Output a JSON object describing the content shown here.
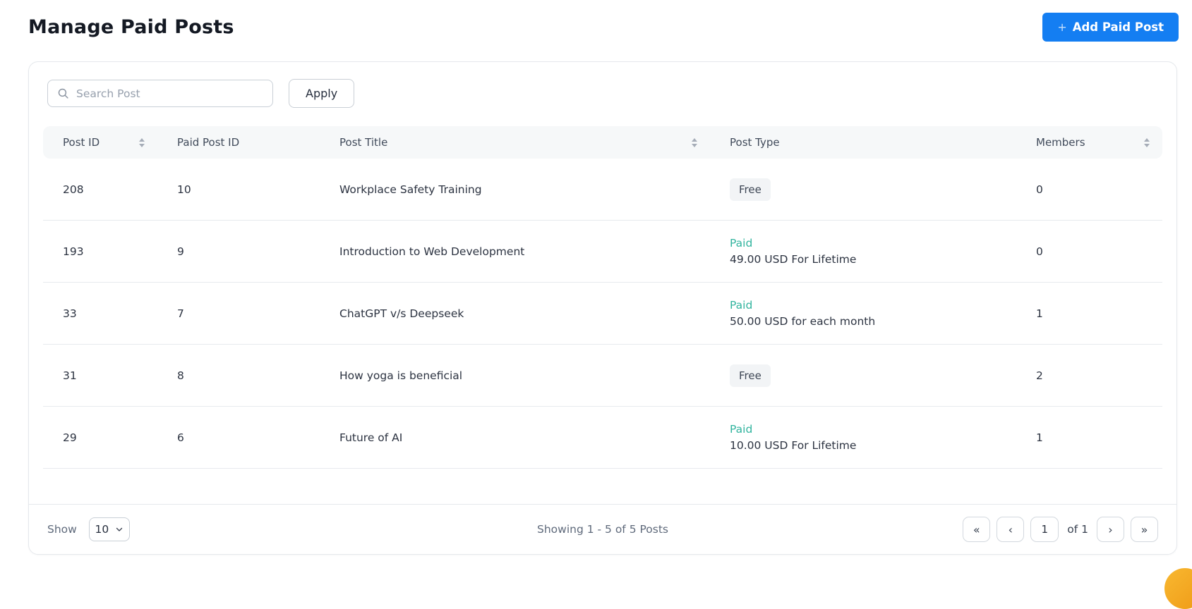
{
  "page": {
    "title": "Manage Paid Posts"
  },
  "header": {
    "add_button": {
      "plus": "+",
      "label": "Add Paid Post"
    }
  },
  "filters": {
    "search_placeholder": "Search Post",
    "search_value": "",
    "apply_label": "Apply"
  },
  "table": {
    "columns": [
      {
        "label": "Post ID",
        "sortable": true
      },
      {
        "label": "Paid Post ID",
        "sortable": false
      },
      {
        "label": "Post Title",
        "sortable": true
      },
      {
        "label": "Post Type",
        "sortable": false
      },
      {
        "label": "Members",
        "sortable": true
      }
    ],
    "rows": [
      {
        "post_id": "208",
        "paid_post_id": "10",
        "title": "Workplace Safety Training",
        "type": "Free",
        "price": "",
        "members": "0"
      },
      {
        "post_id": "193",
        "paid_post_id": "9",
        "title": "Introduction to Web Development",
        "type": "Paid",
        "price": "49.00 USD For Lifetime",
        "members": "0"
      },
      {
        "post_id": "33",
        "paid_post_id": "7",
        "title": "ChatGPT v/s Deepseek",
        "type": "Paid",
        "price": "50.00 USD for each month",
        "members": "1"
      },
      {
        "post_id": "31",
        "paid_post_id": "8",
        "title": "How yoga is beneficial",
        "type": "Free",
        "price": "",
        "members": "2"
      },
      {
        "post_id": "29",
        "paid_post_id": "6",
        "title": "Future of AI",
        "type": "Paid",
        "price": "10.00 USD For Lifetime",
        "members": "1"
      }
    ]
  },
  "footer": {
    "show_label": "Show",
    "page_size": "10",
    "summary": "Showing 1 - 5 of 5 Posts",
    "pagination": {
      "first": "«",
      "prev": "‹",
      "current_page": "1",
      "of_label": "of 1",
      "next": "›",
      "last": "»"
    }
  },
  "colors": {
    "accent_blue": "#147ef2",
    "paid_teal": "#31b49e",
    "free_badge_bg": "#f2f4f6",
    "header_row_bg": "#f6f8f9",
    "chat_bubble_orange": "#f5a623"
  }
}
